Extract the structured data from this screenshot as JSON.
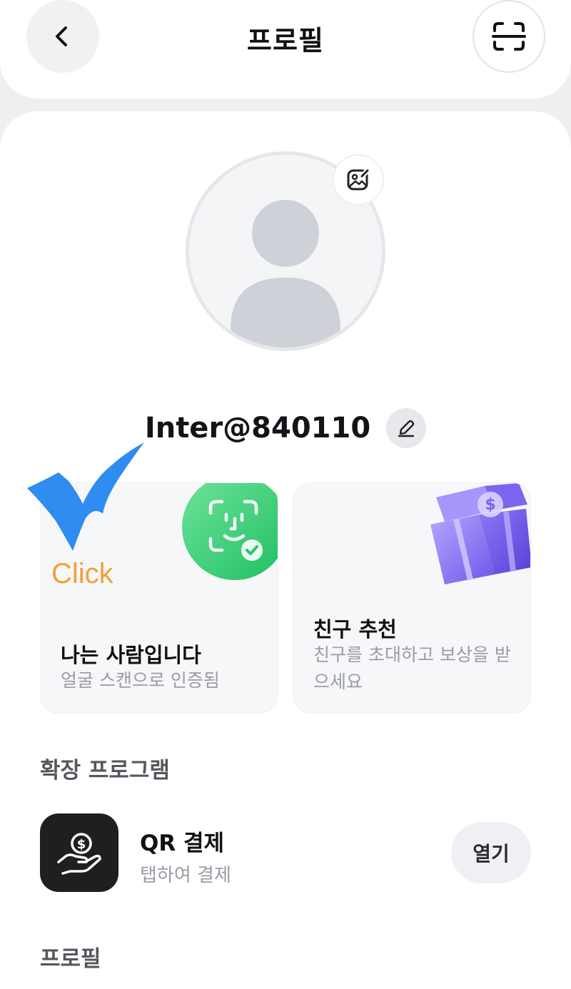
{
  "header": {
    "title": "프로필",
    "back_icon": "chevron-left-icon",
    "scan_icon": "scan-frame-icon"
  },
  "profile": {
    "username": "Inter@840110",
    "avatar_icon": "default-avatar-icon",
    "photo_edit_icon": "image-edit-icon",
    "name_edit_icon": "pencil-icon"
  },
  "overlay": {
    "click_label": "Click",
    "checkmark_color": "#2f8cf0"
  },
  "cards": [
    {
      "title": "나는 사람입니다",
      "subtitle": "얼굴 스캔으로 인증됨",
      "icon": "face-scan-icon",
      "accent": "#3fd07a"
    },
    {
      "title": "친구 추천",
      "subtitle": "친구를 초대하고 보상을 받으세요",
      "icon": "gift-box-icon",
      "accent": "#8f7cf4"
    }
  ],
  "sections": {
    "extensions_title": "확장 프로그램",
    "profile_title": "프로필"
  },
  "extensions": [
    {
      "name": "QR 결제",
      "description": "탭하여 결제",
      "icon": "coin-hand-icon",
      "action_label": "열기"
    }
  ]
}
